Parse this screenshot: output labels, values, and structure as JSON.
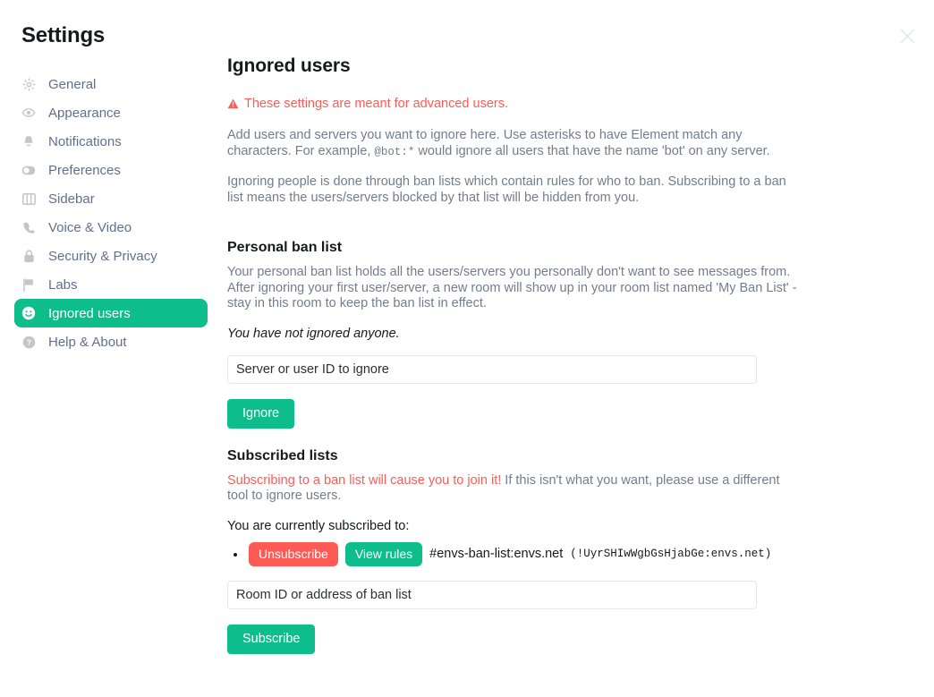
{
  "window": {
    "title": "Settings",
    "close_label": "Close"
  },
  "sidebar": {
    "items": [
      {
        "label": "General",
        "icon": "gear-icon",
        "selected": false
      },
      {
        "label": "Appearance",
        "icon": "eye-icon",
        "selected": false
      },
      {
        "label": "Notifications",
        "icon": "bell-icon",
        "selected": false
      },
      {
        "label": "Preferences",
        "icon": "toggle-icon",
        "selected": false
      },
      {
        "label": "Sidebar",
        "icon": "panels-icon",
        "selected": false
      },
      {
        "label": "Voice & Video",
        "icon": "phone-icon",
        "selected": false
      },
      {
        "label": "Security & Privacy",
        "icon": "lock-icon",
        "selected": false
      },
      {
        "label": "Labs",
        "icon": "flag-icon",
        "selected": false
      },
      {
        "label": "Ignored users",
        "icon": "smiley-icon",
        "selected": true
      },
      {
        "label": "Help & About",
        "icon": "question-icon",
        "selected": false
      }
    ]
  },
  "main": {
    "page_title": "Ignored users",
    "warning": "These settings are meant for advanced users.",
    "intro_part1": "Add users and servers you want to ignore here. Use asterisks to have Element match any characters. For example, ",
    "intro_code": "@bot:*",
    "intro_part2": " would ignore all users that have the name 'bot' on any server.",
    "intro2": "Ignoring people is done through ban lists which contain rules for who to ban. Subscribing to a ban list means the users/servers blocked by that list will be hidden from you.",
    "personal": {
      "title": "Personal ban list",
      "description": "Your personal ban list holds all the users/servers you personally don't want to see messages from. After ignoring your first user/server, a new room will show up in your room list named 'My Ban List' - stay in this room to keep the ban list in effect.",
      "empty_note": "You have not ignored anyone.",
      "input_placeholder": "Server or user ID to ignore",
      "input_value": "",
      "button_label": "Ignore"
    },
    "subscribed": {
      "title": "Subscribed lists",
      "warning_red": "Subscribing to a ban list will cause you to join it!",
      "warning_grey": " If this isn't what you want, please use a different tool to ignore users.",
      "currently_label": "You are currently subscribed to:",
      "rows": [
        {
          "unsubscribe_label": "Unsubscribe",
          "view_rules_label": "View rules",
          "alias": "#envs-ban-list:envs.net",
          "room_id": "(!UyrSHIwWgbGsHjabGe:envs.net)"
        }
      ],
      "input_placeholder": "Room ID or address of ban list",
      "input_value": "",
      "button_label": "Subscribe"
    }
  },
  "colors": {
    "accent_green": "#0dbd8b",
    "danger_red": "#ff5b55",
    "body_text": "#737d8c",
    "heading_text": "#17191c",
    "nav_text": "#61708b",
    "icon_grey": "#c1c6cd",
    "input_border": "#e3e8f0"
  }
}
